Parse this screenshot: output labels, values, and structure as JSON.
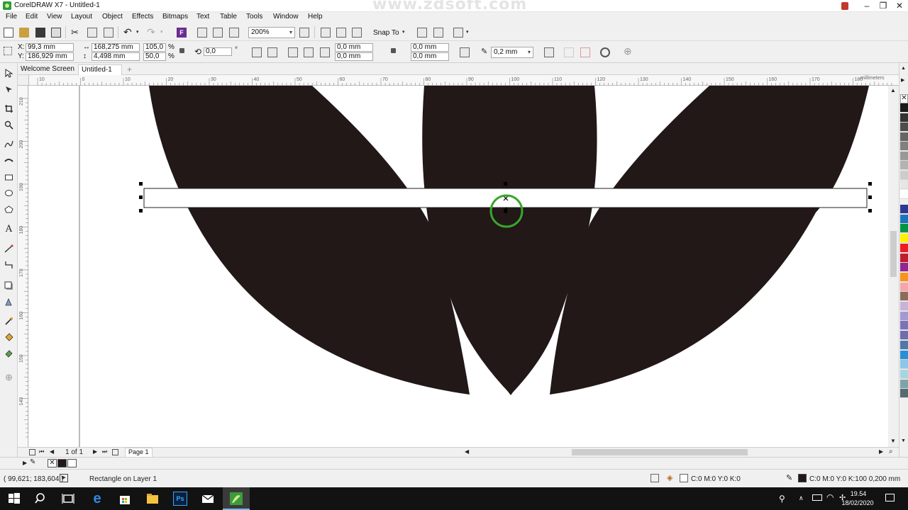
{
  "window": {
    "title": "CorelDRAW X7 - Untitled-1",
    "watermark": "www.zdsoft.com"
  },
  "menu": [
    "File",
    "Edit",
    "View",
    "Layout",
    "Object",
    "Effects",
    "Bitmaps",
    "Text",
    "Table",
    "Tools",
    "Window",
    "Help"
  ],
  "toolbar": {
    "zoom": "200%",
    "snap_to": "Snap To"
  },
  "propbar": {
    "x": "99,3 mm",
    "y": "186,929 mm",
    "width": "168,275 mm",
    "height": "4,498 mm",
    "scale_x": "105,0",
    "scale_y": "50,0",
    "percent": "%",
    "rotation": "0,0",
    "degree": "°",
    "corner_1": "0,0 mm",
    "corner_2": "0,0 mm",
    "corner_3": "0,0 mm",
    "corner_4": "0,0 mm",
    "outline_width": "0,2 mm"
  },
  "tabs": {
    "welcome": "Welcome Screen",
    "doc": "Untitled-1",
    "add": "+"
  },
  "ruler": {
    "units": "millimeters",
    "h_ticks": [
      "10",
      "0",
      "10",
      "20",
      "30",
      "40",
      "50",
      "60",
      "70",
      "80",
      "90",
      "100",
      "110",
      "120",
      "130",
      "140",
      "150",
      "160",
      "170",
      "180"
    ],
    "v_ticks": [
      "210",
      "200",
      "190",
      "180",
      "170",
      "160",
      "150",
      "140"
    ]
  },
  "pager": {
    "page_count": "1 of 1",
    "page_tab": "Page 1"
  },
  "status": {
    "coords": "( 99,621; 183,604 )",
    "object_info": "Rectangle on Layer 1",
    "fill_info": "C:0 M:0 Y:0 K:0",
    "outline_info": "C:0 M:0 Y:0 K:100  0,200 mm"
  },
  "taskbar": {
    "time": "19.54",
    "date": "18/02/2020"
  },
  "palette_colors": [
    "#1a1a1a",
    "#333333",
    "#4d4d4d",
    "#666666",
    "#808080",
    "#999999",
    "#b3b3b3",
    "#cccccc",
    "#e6e6e6",
    "#ffffff",
    "#2b3990",
    "#1c75bc",
    "#009444",
    "#fff200",
    "#ed1c24",
    "#be1e2d",
    "#92278f",
    "#f7941d",
    "#f6a6a6",
    "#8b6d5c",
    "#c8b2d8",
    "#a29bd0",
    "#7b73b8",
    "#6d6eab",
    "#4f79a6",
    "#2b8fd6",
    "#8cc6e8",
    "#a6d6e0",
    "#7fa3a8",
    "#566a72"
  ],
  "colors": {
    "shape_fill": "#211817",
    "selection_ring": "#3aa52a"
  }
}
